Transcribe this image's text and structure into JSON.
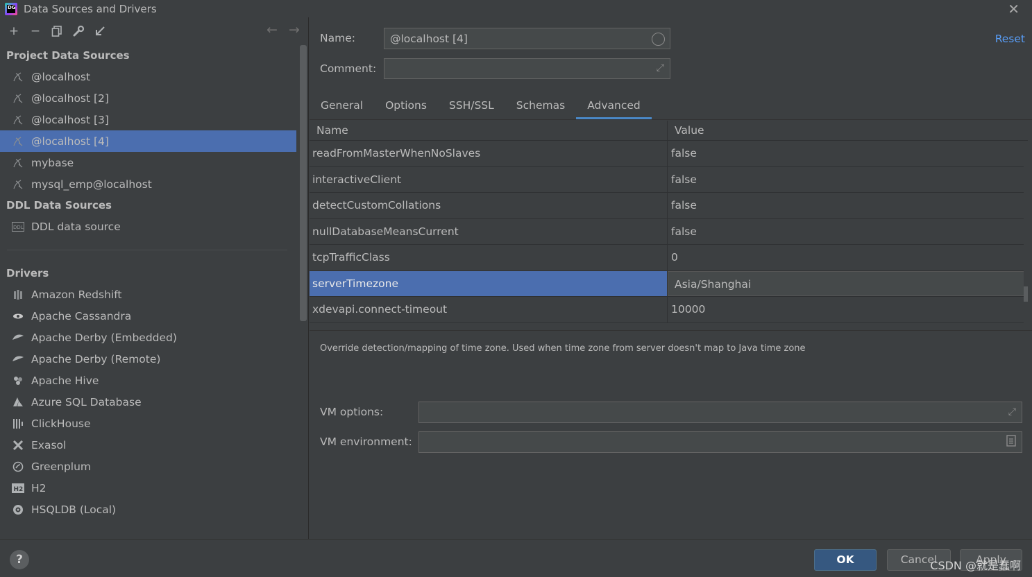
{
  "window": {
    "title": "Data Sources and Drivers",
    "close_glyph": "✕"
  },
  "toolbar": {
    "add": "+",
    "remove": "−",
    "copy": "⧉",
    "settings": "🔧",
    "import": "↙",
    "back": "←",
    "forward": "→"
  },
  "project_sources": {
    "header": "Project Data Sources",
    "items": [
      {
        "label": "@localhost",
        "selected": false
      },
      {
        "label": "@localhost [2]",
        "selected": false
      },
      {
        "label": "@localhost [3]",
        "selected": false
      },
      {
        "label": "@localhost [4]",
        "selected": true
      },
      {
        "label": "mybase",
        "selected": false
      },
      {
        "label": "mysql_emp@localhost",
        "selected": false
      }
    ]
  },
  "ddl_sources": {
    "header": "DDL Data Sources",
    "items": [
      {
        "label": "DDL data source"
      }
    ]
  },
  "drivers": {
    "header": "Drivers",
    "items": [
      {
        "label": "Amazon Redshift",
        "icon": "redshift-icon"
      },
      {
        "label": "Apache Cassandra",
        "icon": "cassandra-icon"
      },
      {
        "label": "Apache Derby (Embedded)",
        "icon": "derby-icon"
      },
      {
        "label": "Apache Derby (Remote)",
        "icon": "derby-icon"
      },
      {
        "label": "Apache Hive",
        "icon": "hive-icon"
      },
      {
        "label": "Azure SQL Database",
        "icon": "azure-icon"
      },
      {
        "label": "ClickHouse",
        "icon": "clickhouse-icon"
      },
      {
        "label": "Exasol",
        "icon": "exasol-icon"
      },
      {
        "label": "Greenplum",
        "icon": "greenplum-icon"
      },
      {
        "label": "H2",
        "icon": "h2-icon"
      },
      {
        "label": "HSQLDB (Local)",
        "icon": "hsqldb-icon"
      }
    ]
  },
  "form": {
    "name_label": "Name:",
    "name_value": "@localhost [4]",
    "comment_label": "Comment:",
    "comment_value": "",
    "reset_label": "Reset"
  },
  "tabs": [
    {
      "label": "General",
      "active": false
    },
    {
      "label": "Options",
      "active": false
    },
    {
      "label": "SSH/SSL",
      "active": false
    },
    {
      "label": "Schemas",
      "active": false
    },
    {
      "label": "Advanced",
      "active": true
    }
  ],
  "properties": {
    "columns": {
      "name": "Name",
      "value": "Value"
    },
    "rows": [
      {
        "name": "readFromMasterWhenNoSlaves",
        "value": "false",
        "selected": false
      },
      {
        "name": "interactiveClient",
        "value": "false",
        "selected": false
      },
      {
        "name": "detectCustomCollations",
        "value": "false",
        "selected": false
      },
      {
        "name": "nullDatabaseMeansCurrent",
        "value": "false",
        "selected": false
      },
      {
        "name": "tcpTrafficClass",
        "value": "0",
        "selected": false
      },
      {
        "name": "serverTimezone",
        "value": "Asia/Shanghai",
        "selected": true
      },
      {
        "name": "xdevapi.connect-timeout",
        "value": "10000",
        "selected": false
      }
    ],
    "description": "Override detection/mapping of time zone. Used when time zone from server doesn't map to Java time zone"
  },
  "vm": {
    "options_label": "VM options:",
    "options_value": "",
    "env_label": "VM environment:",
    "env_value": ""
  },
  "buttons": {
    "help": "?",
    "ok": "OK",
    "cancel": "Cancel",
    "apply": "Apply"
  },
  "watermark": "CSDN @就是蠢啊",
  "colors": {
    "selection": "#4b6eaf",
    "accent": "#4a88c7",
    "link": "#589df6",
    "ok_button": "#365880"
  }
}
